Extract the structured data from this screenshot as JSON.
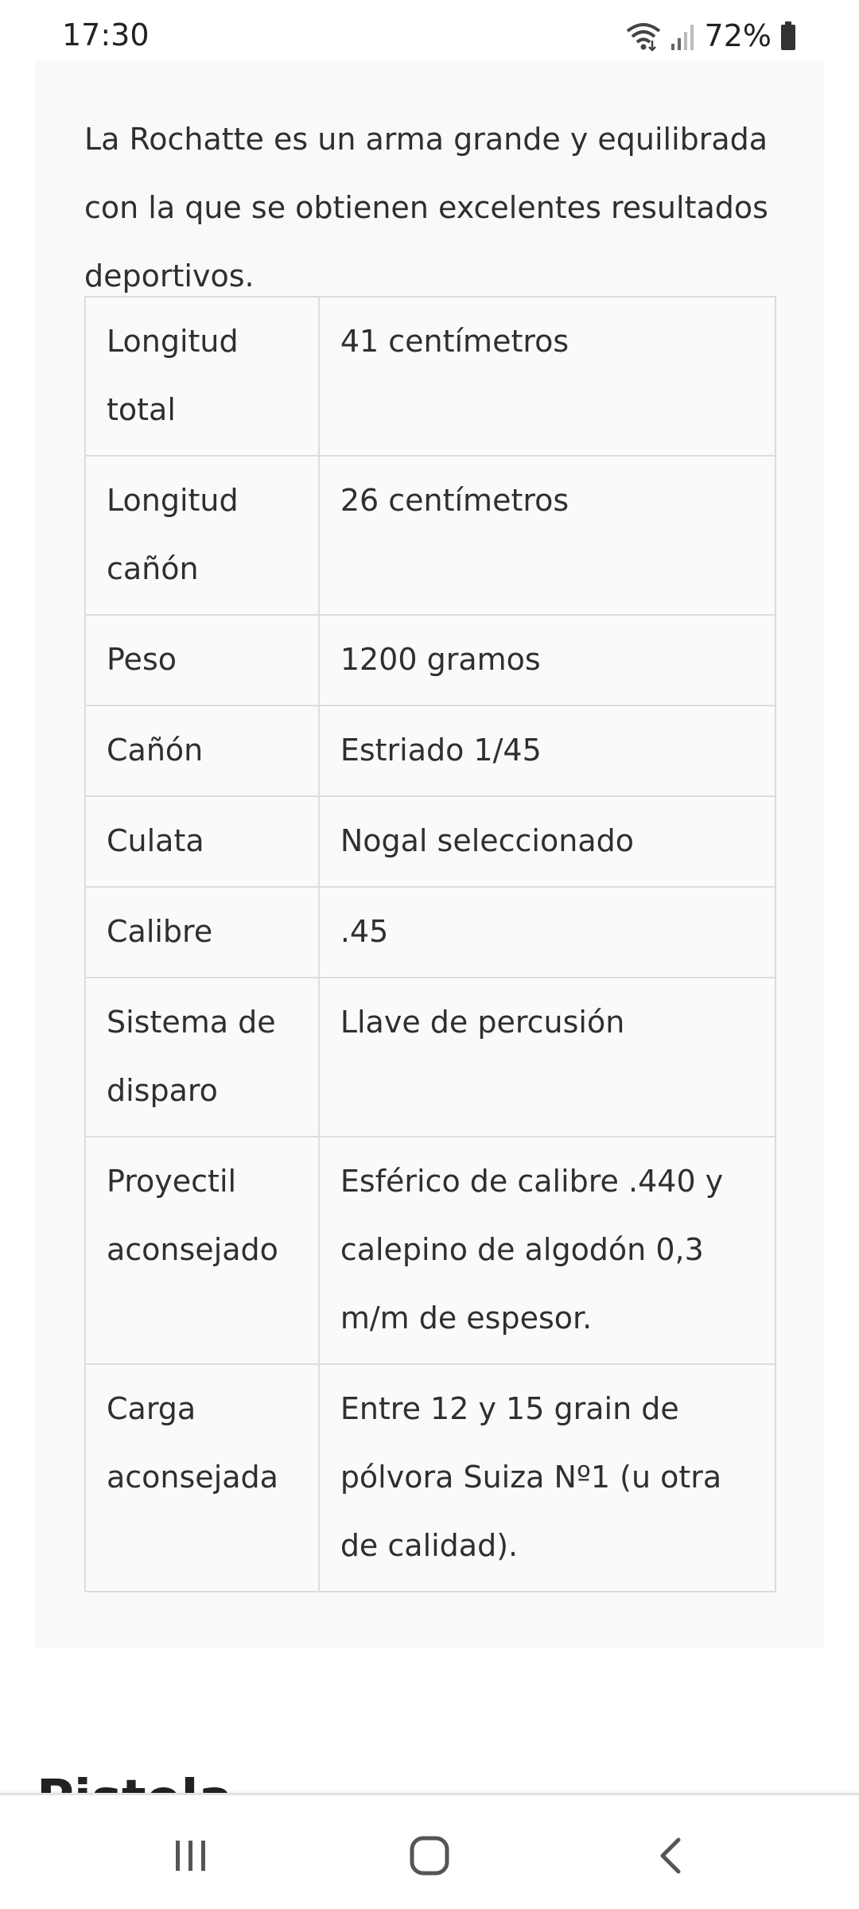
{
  "status_bar": {
    "time": "17:30",
    "battery_percent": "72%",
    "icons": [
      "wifi-icon",
      "signal-icon",
      "battery-icon"
    ]
  },
  "article": {
    "intro": "La Rochatte es un arma grande y equilibrada con la que se obtienen excelentes resultados deportivos.",
    "specs": [
      {
        "label": "Longitud total",
        "value": "41 centímetros"
      },
      {
        "label": "Longitud cañón",
        "value": "26 centímetros"
      },
      {
        "label": "Peso",
        "value": "1200 gramos"
      },
      {
        "label": "Cañón",
        "value": "Estriado 1/45"
      },
      {
        "label": "Culata",
        "value": "Nogal seleccionado"
      },
      {
        "label": "Calibre",
        "value": ".45"
      },
      {
        "label": "Sistema de disparo",
        "value": "Llave de percusión"
      },
      {
        "label": "Proyectil aconsejado",
        "value": "Esférico de calibre .440 y calepino de algodón 0,3 m/m de espesor."
      },
      {
        "label": "Carga aconsejada",
        "value": "Entre 12 y 15 grain de pólvora Suiza Nº1 (u otra de calidad)."
      }
    ],
    "next_heading": "Pistola"
  },
  "nav_bar": {
    "buttons": [
      "recents-icon",
      "home-icon",
      "back-icon"
    ]
  },
  "colors": {
    "card_background": "#f9f9f9",
    "table_border": "#dcdcdc",
    "text": "#2f2f2f"
  }
}
